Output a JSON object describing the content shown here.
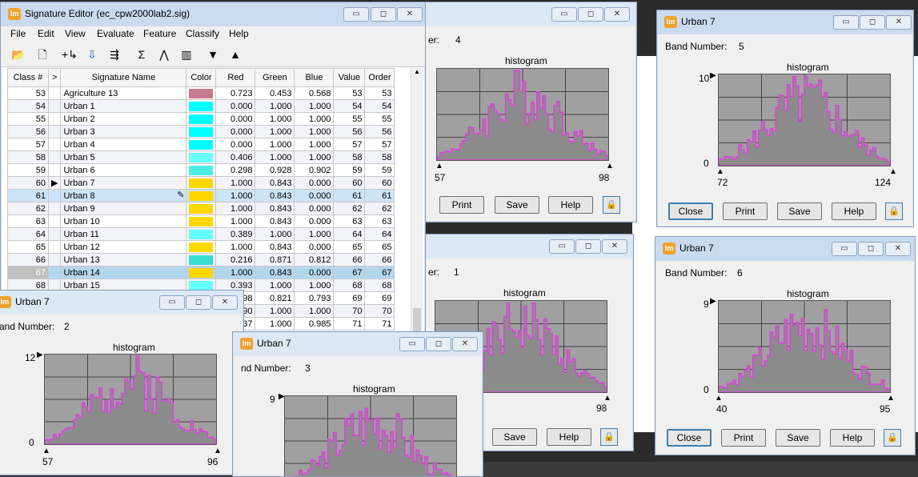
{
  "editor": {
    "title": "Signature Editor (ec_cpw2000lab2.sig)",
    "menu": [
      "File",
      "Edit",
      "View",
      "Evaluate",
      "Feature",
      "Classify",
      "Help"
    ],
    "columns": [
      "Class #",
      ">",
      "Signature Name",
      "Color",
      "Red",
      "Green",
      "Blue",
      "Value",
      "Order"
    ],
    "rows": [
      {
        "cls": "53",
        "mark": "",
        "name": "Agriculture 13",
        "color": "#c87a8e",
        "red": "0.723",
        "green": "0.453",
        "blue": "0.568",
        "value": "53",
        "order": "53"
      },
      {
        "cls": "54",
        "mark": "",
        "name": "Urban 1",
        "color": "#00ffff",
        "red": "0.000",
        "green": "1.000",
        "blue": "1.000",
        "value": "54",
        "order": "54"
      },
      {
        "cls": "55",
        "mark": "",
        "name": "Urban 2",
        "color": "#00ffff",
        "red": "0.000",
        "green": "1.000",
        "blue": "1.000",
        "value": "55",
        "order": "55"
      },
      {
        "cls": "56",
        "mark": "",
        "name": "Urban 3",
        "color": "#00ffff",
        "red": "0.000",
        "green": "1.000",
        "blue": "1.000",
        "value": "56",
        "order": "56"
      },
      {
        "cls": "57",
        "mark": "",
        "name": "Urban 4",
        "color": "#00ffff",
        "red": "0.000",
        "green": "1.000",
        "blue": "1.000",
        "value": "57",
        "order": "57"
      },
      {
        "cls": "58",
        "mark": "",
        "name": "Urban 5",
        "color": "#67ffff",
        "red": "0.406",
        "green": "1.000",
        "blue": "1.000",
        "value": "58",
        "order": "58"
      },
      {
        "cls": "59",
        "mark": "",
        "name": "Urban 6",
        "color": "#4ceee6",
        "red": "0.298",
        "green": "0.928",
        "blue": "0.902",
        "value": "59",
        "order": "59"
      },
      {
        "cls": "60",
        "mark": "▶",
        "name": "Urban 7",
        "color": "#ffd700",
        "red": "1.000",
        "green": "0.843",
        "blue": "0.000",
        "value": "60",
        "order": "60"
      },
      {
        "cls": "61",
        "mark": "",
        "name": "Urban 8",
        "color": "#ffd700",
        "red": "1.000",
        "green": "0.843",
        "blue": "0.000",
        "value": "61",
        "order": "61"
      },
      {
        "cls": "62",
        "mark": "",
        "name": "Urban 9",
        "color": "#ffd700",
        "red": "1.000",
        "green": "0.843",
        "blue": "0.000",
        "value": "62",
        "order": "62"
      },
      {
        "cls": "63",
        "mark": "",
        "name": "Urban 10",
        "color": "#ffd700",
        "red": "1.000",
        "green": "0.843",
        "blue": "0.000",
        "value": "63",
        "order": "63"
      },
      {
        "cls": "64",
        "mark": "",
        "name": "Urban 11",
        "color": "#63ffff",
        "red": "0.389",
        "green": "1.000",
        "blue": "1.000",
        "value": "64",
        "order": "64"
      },
      {
        "cls": "65",
        "mark": "",
        "name": "Urban 12",
        "color": "#ffd700",
        "red": "1.000",
        "green": "0.843",
        "blue": "0.000",
        "value": "65",
        "order": "65"
      },
      {
        "cls": "66",
        "mark": "",
        "name": "Urban 13",
        "color": "#37decf",
        "red": "0.216",
        "green": "0.871",
        "blue": "0.812",
        "value": "66",
        "order": "66"
      },
      {
        "cls": "67",
        "mark": "",
        "name": "Urban 14",
        "color": "#ffd700",
        "red": "1.000",
        "green": "0.843",
        "blue": "0.000",
        "value": "67",
        "order": "67"
      },
      {
        "cls": "68",
        "mark": "",
        "name": "Urban 15",
        "color": "#64ffff",
        "red": "0.393",
        "green": "1.000",
        "blue": "1.000",
        "value": "68",
        "order": "68"
      },
      {
        "cls": "",
        "mark": "",
        "name": "",
        "color": "",
        "red": "298",
        "green": "0.821",
        "blue": "0.793",
        "value": "69",
        "order": "69"
      },
      {
        "cls": "",
        "mark": "",
        "name": "",
        "color": "",
        "red": "590",
        "green": "1.000",
        "blue": "1.000",
        "value": "70",
        "order": "70"
      },
      {
        "cls": "",
        "mark": "",
        "name": "",
        "color": "",
        "red": "437",
        "green": "1.000",
        "blue": "0.985",
        "value": "71",
        "order": "71"
      }
    ]
  },
  "histwin": [
    {
      "title": "",
      "band_label": "er:",
      "band": "4",
      "hist_label": "histogram",
      "ymax": "",
      "ymin": "",
      "xmin": "57",
      "xmax": "98",
      "buttons": [
        "Print",
        "Save",
        "Help"
      ]
    },
    {
      "title": "Urban 7",
      "band_label": "Band Number:",
      "band": "5",
      "hist_label": "histogram",
      "ymax": "10",
      "ymin": "0",
      "xmin": "72",
      "xmax": "124",
      "buttons": [
        "Close",
        "Print",
        "Save",
        "Help"
      ]
    },
    {
      "title": "",
      "band_label": "er:",
      "band": "1",
      "hist_label": "histogram",
      "ymax": "",
      "ymin": "",
      "xmin": "",
      "xmax": "98",
      "buttons": [
        "Save",
        "Help"
      ]
    },
    {
      "title": "Urban 7",
      "band_label": "Band Number:",
      "band": "6",
      "hist_label": "histogram",
      "ymax": "9",
      "ymin": "0",
      "xmin": "40",
      "xmax": "95",
      "buttons": [
        "Close",
        "Print",
        "Save",
        "Help"
      ]
    },
    {
      "title": "Urban 7",
      "band_label": "and Number:",
      "band": "2",
      "hist_label": "histogram",
      "ymax": "12",
      "ymin": "0",
      "xmin": "57",
      "xmax": "96",
      "buttons": []
    },
    {
      "title": "Urban 7",
      "band_label": "nd Number:",
      "band": "3",
      "hist_label": "histogram",
      "ymax": "9",
      "ymin": "",
      "xmin": "",
      "xmax": "",
      "buttons": []
    }
  ],
  "icons": {
    "lock": "lock-icon",
    "app": "imagine-app-icon"
  },
  "colors": {
    "plot_bg": "#a0a0a0",
    "hist_line": "#e040e0",
    "hist_fill": "#8c8c8c",
    "selected_row": "#b4d7f0",
    "highlight_row": "#cce4f7"
  }
}
